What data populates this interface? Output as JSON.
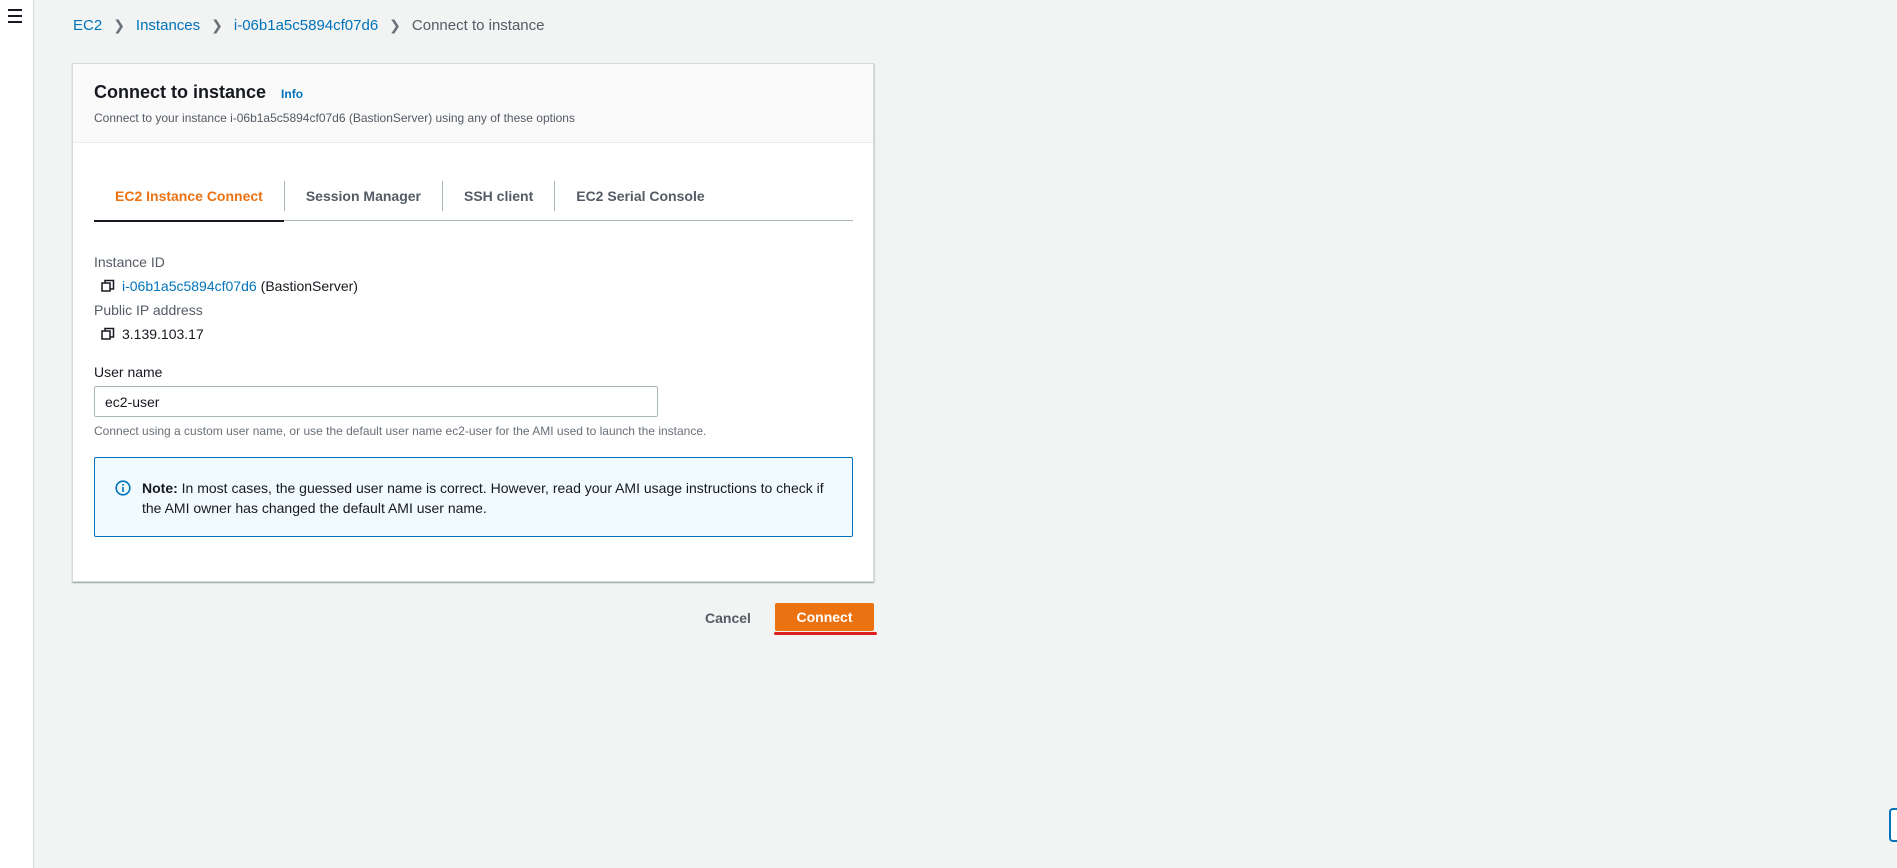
{
  "breadcrumb": {
    "items": [
      "EC2",
      "Instances",
      "i-06b1a5c5894cf07d6"
    ],
    "current": "Connect to instance"
  },
  "card": {
    "title": "Connect to instance",
    "info": "Info",
    "description": "Connect to your instance i-06b1a5c5894cf07d6 (BastionServer) using any of these options"
  },
  "tabs": [
    {
      "label": "EC2 Instance Connect",
      "active": true
    },
    {
      "label": "Session Manager",
      "active": false
    },
    {
      "label": "SSH client",
      "active": false
    },
    {
      "label": "EC2 Serial Console",
      "active": false
    }
  ],
  "instance": {
    "label": "Instance ID",
    "id": "i-06b1a5c5894cf07d6",
    "name": "(BastionServer)"
  },
  "public_ip": {
    "label": "Public IP address",
    "value": "3.139.103.17"
  },
  "user_name": {
    "label": "User name",
    "value": "ec2-user",
    "hint": "Connect using a custom user name, or use the default user name ec2-user for the AMI used to launch the instance."
  },
  "note": {
    "prefix": "Note:",
    "text": " In most cases, the guessed user name is correct. However, read your AMI usage instructions to check if the AMI owner has changed the default AMI user name."
  },
  "actions": {
    "cancel": "Cancel",
    "connect": "Connect"
  },
  "colors": {
    "accent": "#ec7211",
    "link": "#0073bb",
    "info_bg": "#f1faff",
    "annotation": "#e02020"
  },
  "icons": {
    "menu": "hamburger-menu-icon",
    "copy": "copy-icon",
    "info": "info-circle-icon",
    "breadcrumb_sep": "chevron-right-icon"
  }
}
